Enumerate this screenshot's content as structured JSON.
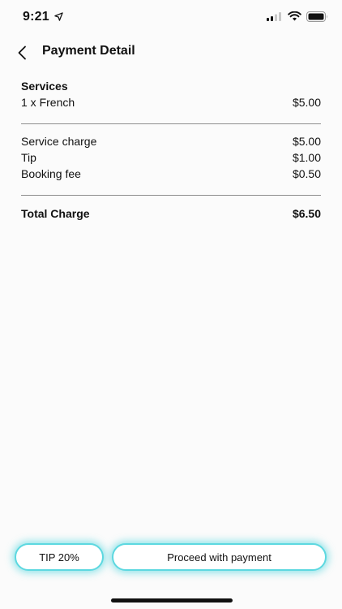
{
  "status": {
    "time": "9:21",
    "icons": [
      "location-arrow-icon",
      "cellular-signal-icon",
      "wifi-icon",
      "battery-icon"
    ]
  },
  "header": {
    "title": "Payment Detail",
    "back_icon": "chevron-left-icon"
  },
  "services": {
    "heading": "Services",
    "items": [
      {
        "label": "1 x French",
        "amount": "$5.00"
      }
    ]
  },
  "charges": [
    {
      "label": "Service charge",
      "amount": "$5.00"
    },
    {
      "label": "Tip",
      "amount": "$1.00"
    },
    {
      "label": "Booking fee",
      "amount": "$0.50"
    }
  ],
  "total": {
    "label": "Total Charge",
    "amount": "$6.50"
  },
  "actions": {
    "tip_label": "TIP 20%",
    "proceed_label": "Proceed with payment"
  },
  "colors": {
    "accent_glow": "#5dd8e0",
    "divider": "#8e8e8e",
    "background": "#fbfbfb"
  }
}
